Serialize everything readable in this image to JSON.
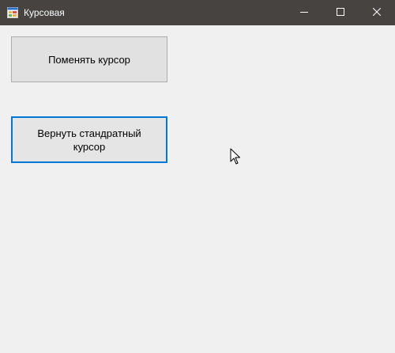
{
  "window": {
    "title": "Курсовая",
    "titlebar_color": "#464340",
    "background_color": "#f0f0f0"
  },
  "titlebar": {
    "app_icon": "form-icon",
    "minimize_icon": "minimize-icon",
    "maximize_icon": "maximize-icon",
    "close_icon": "close-icon"
  },
  "buttons": {
    "change_cursor_label": "Поменять курсор",
    "restore_cursor_label": "Вернуть стандратный курсор",
    "focus_border_color": "#0078d7"
  },
  "cursor": {
    "icon": "mouse-pointer-icon"
  }
}
